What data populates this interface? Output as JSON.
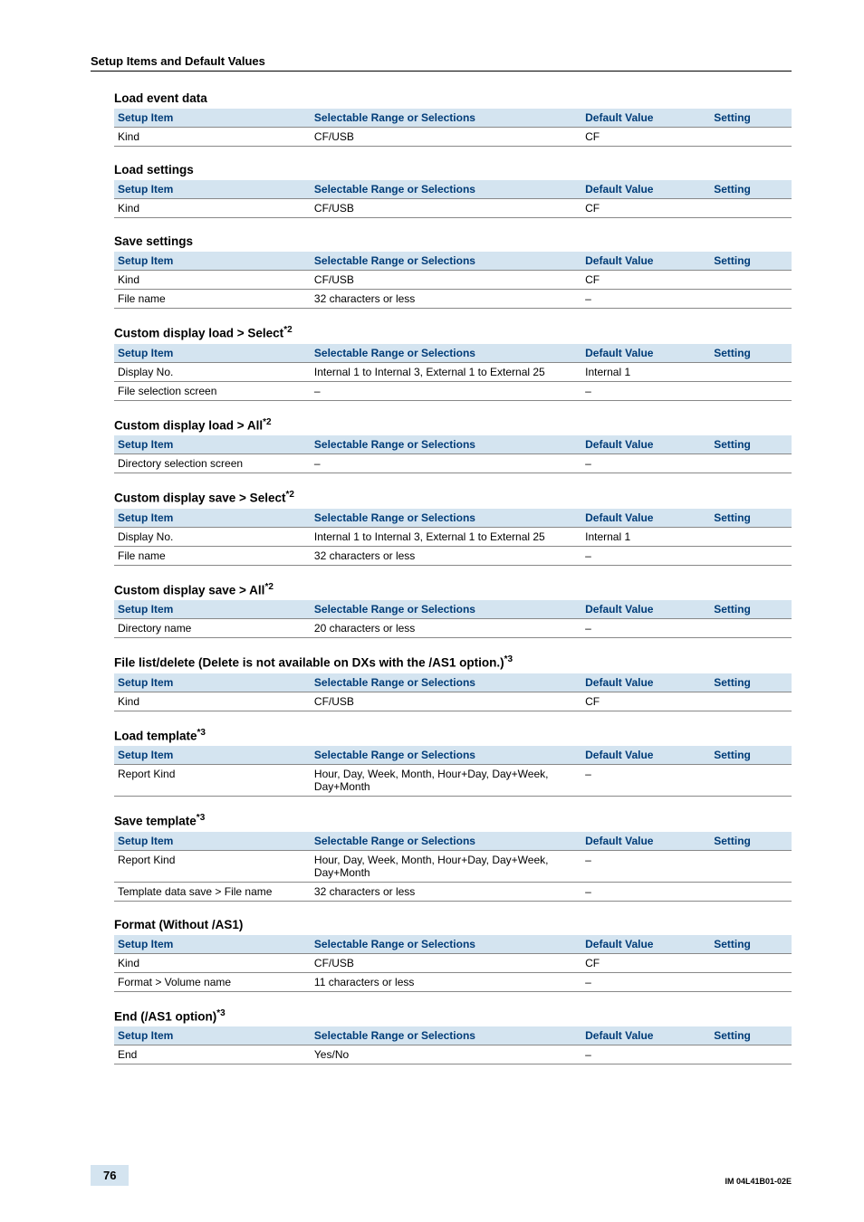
{
  "cornerTitle": "Setup Items and Default Values",
  "headers": {
    "item": "Setup Item",
    "range": "Selectable Range or Selections",
    "def": "Default Value",
    "set": "Setting"
  },
  "sections": [
    {
      "title": "Load event data",
      "sup": "",
      "rows": [
        {
          "item": "Kind",
          "range": "CF/USB",
          "def": "CF",
          "set": ""
        }
      ]
    },
    {
      "title": "Load settings",
      "sup": "",
      "rows": [
        {
          "item": "Kind",
          "range": "CF/USB",
          "def": "CF",
          "set": ""
        }
      ]
    },
    {
      "title": "Save settings",
      "sup": "",
      "rows": [
        {
          "item": "Kind",
          "range": "CF/USB",
          "def": "CF",
          "set": ""
        },
        {
          "item": "File name",
          "range": "32 characters or less",
          "def": "–",
          "set": ""
        }
      ]
    },
    {
      "title": "Custom display load > Select",
      "sup": "*2",
      "rows": [
        {
          "item": "Display No.",
          "range": "Internal 1 to Internal 3, External 1 to External 25",
          "def": "Internal 1",
          "set": ""
        },
        {
          "item": "File selection screen",
          "range": "–",
          "def": "–",
          "set": ""
        }
      ]
    },
    {
      "title": "Custom display load > All",
      "sup": "*2",
      "rows": [
        {
          "item": "Directory selection screen",
          "range": "–",
          "def": "–",
          "set": ""
        }
      ]
    },
    {
      "title": "Custom display save > Select",
      "sup": "*2",
      "rows": [
        {
          "item": "Display No.",
          "range": "Internal 1 to Internal 3, External 1 to External 25",
          "def": "Internal 1",
          "set": ""
        },
        {
          "item": "File name",
          "range": "32 characters or less",
          "def": "–",
          "set": ""
        }
      ]
    },
    {
      "title": "Custom display save > All",
      "sup": "*2",
      "rows": [
        {
          "item": "Directory name",
          "range": "20 characters or less",
          "def": "–",
          "set": ""
        }
      ]
    },
    {
      "title": "File list/delete (Delete is not available on DXs with the /AS1 option.)",
      "sup": "*3",
      "rows": [
        {
          "item": "Kind",
          "range": "CF/USB",
          "def": "CF",
          "set": ""
        }
      ]
    },
    {
      "title": "Load template",
      "sup": "*3",
      "rows": [
        {
          "item": "Report Kind",
          "range": "Hour, Day, Week, Month, Hour+Day, Day+Week, Day+Month",
          "def": "–",
          "set": ""
        }
      ]
    },
    {
      "title": "Save template",
      "sup": "*3",
      "rows": [
        {
          "item": "Report Kind",
          "range": "Hour, Day, Week, Month, Hour+Day, Day+Week, Day+Month",
          "def": "–",
          "set": ""
        },
        {
          "item": "Template data save > File name",
          "range": "32 characters or less",
          "def": "–",
          "set": ""
        }
      ]
    },
    {
      "title": "Format (Without /AS1)",
      "sup": "",
      "rows": [
        {
          "item": "Kind",
          "range": "CF/USB",
          "def": "CF",
          "set": ""
        },
        {
          "item": "Format > Volume name",
          "range": "11 characters or less",
          "def": "–",
          "set": ""
        }
      ]
    },
    {
      "title": "End (/AS1 option)",
      "sup": "*3",
      "rows": [
        {
          "item": "End",
          "range": "Yes/No",
          "def": "–",
          "set": ""
        }
      ]
    }
  ],
  "footer": {
    "page": "76",
    "manual": "IM 04L41B01-02E"
  }
}
